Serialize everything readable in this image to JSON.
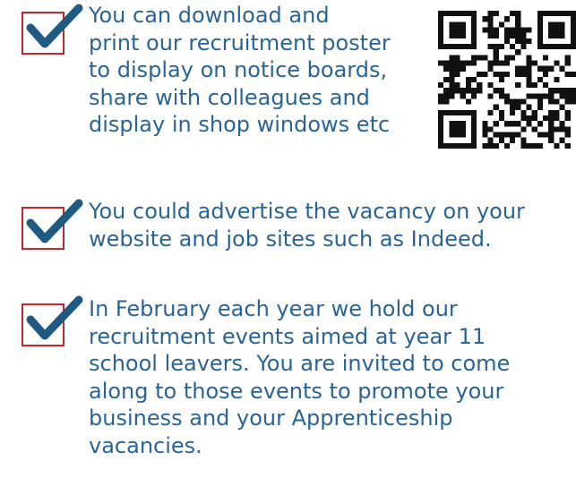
{
  "colors": {
    "checkbox_border": "#c1272d",
    "checkmark": "#1f5a82",
    "text": "#2a6496",
    "qr": "#111111"
  },
  "items": [
    {
      "icon": "checkbox-checked-icon",
      "lines": [
        "You can download and",
        "print our recruitment poster",
        "to display on notice boards,",
        "share with colleagues and",
        "display in shop windows etc"
      ]
    },
    {
      "icon": "checkbox-checked-icon",
      "lines": [
        "You could advertise the vacancy on your",
        "website and job sites such as Indeed."
      ]
    },
    {
      "icon": "checkbox-checked-icon",
      "lines": [
        "In February each year we hold our",
        "recruitment events aimed at year 11",
        "school leavers. You are invited to come",
        "along to those events to promote your",
        "business and your Apprenticeship",
        "vacancies."
      ]
    }
  ],
  "qr_code": {
    "icon": "qr-code-icon"
  }
}
